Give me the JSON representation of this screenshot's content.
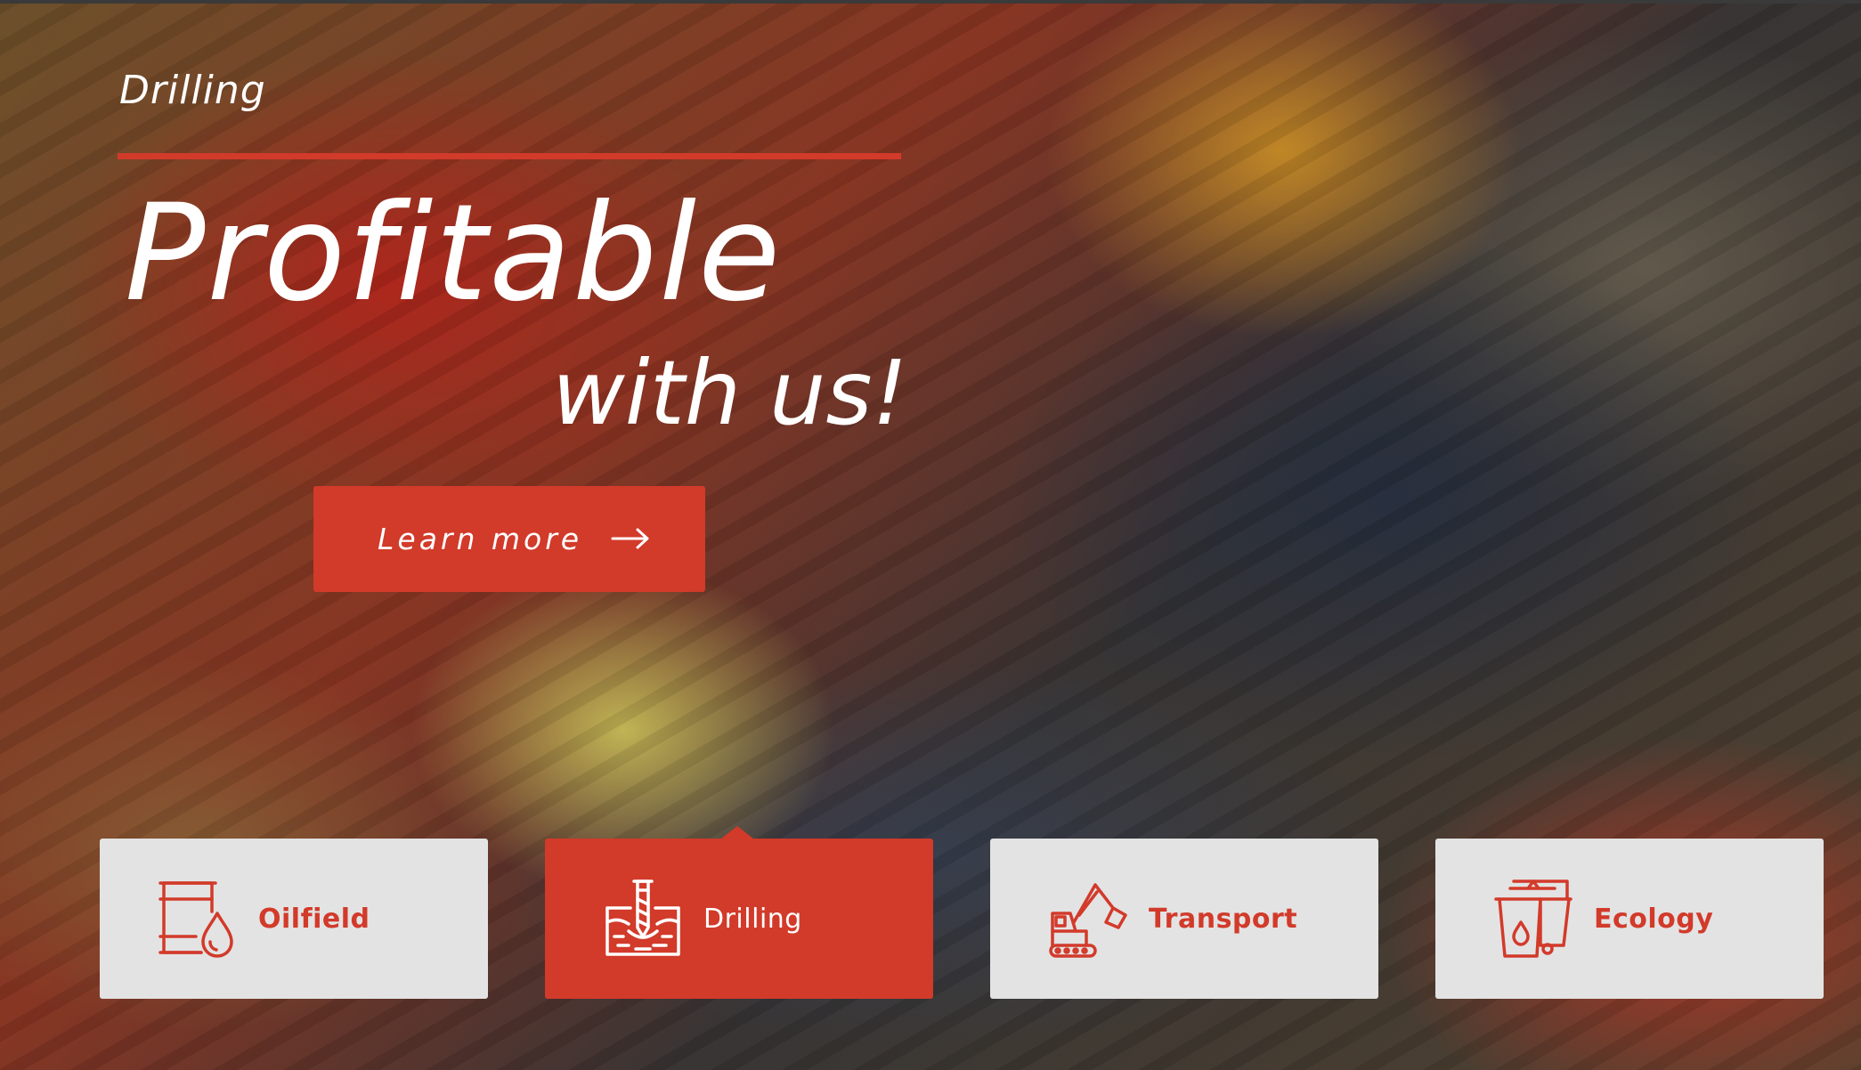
{
  "hero": {
    "eyebrow": "Drilling",
    "headline_line1": "Profitable",
    "headline_line2": "with us!",
    "cta_label": "Learn more"
  },
  "categories": [
    {
      "label": "Oilfield",
      "icon": "oil-barrel-drop-icon",
      "active": false
    },
    {
      "label": "Drilling",
      "icon": "drill-ground-icon",
      "active": true
    },
    {
      "label": "Transport",
      "icon": "excavator-icon",
      "active": false
    },
    {
      "label": "Ecology",
      "icon": "waste-bin-icon",
      "active": false
    }
  ],
  "colors": {
    "accent": "#d23a2a",
    "card_bg": "#e3e3e3",
    "text_light": "#ffffff"
  }
}
